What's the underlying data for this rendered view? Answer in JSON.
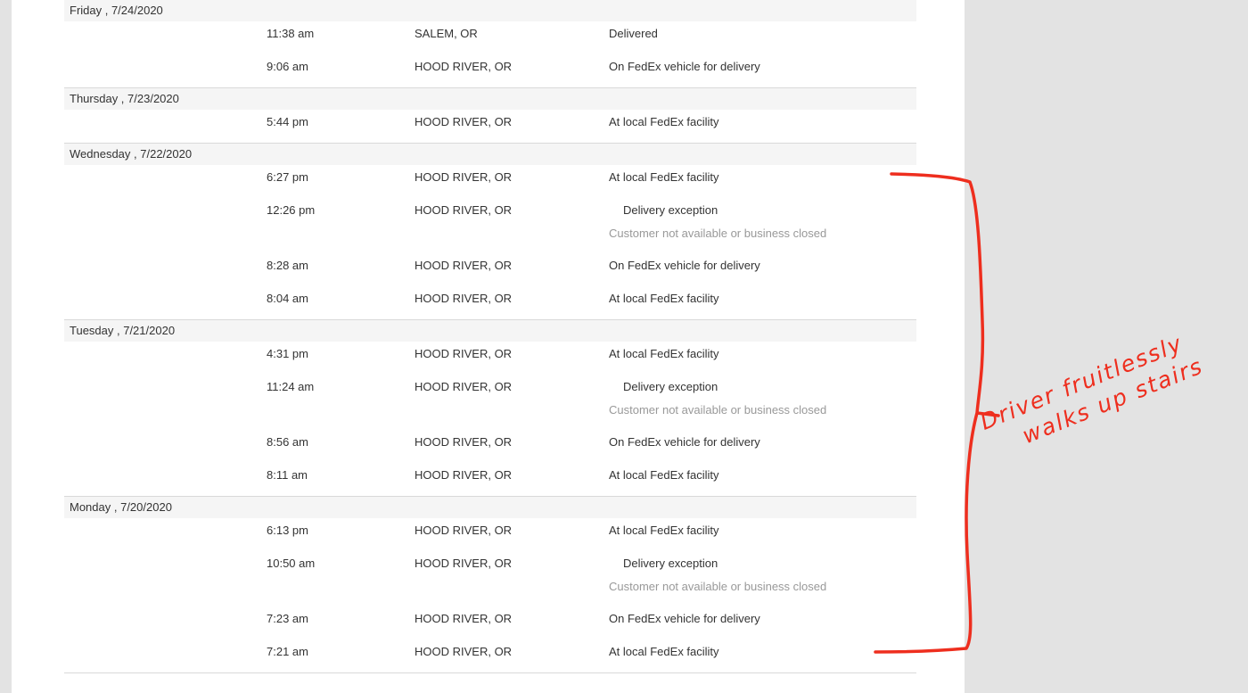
{
  "days": [
    {
      "date": "Friday , 7/24/2020",
      "events": [
        {
          "time": "11:38 am",
          "location": "SALEM, OR",
          "status": "Delivered"
        },
        {
          "time": "9:06 am",
          "location": "HOOD RIVER, OR",
          "status": "On FedEx vehicle for delivery"
        }
      ]
    },
    {
      "date": "Thursday , 7/23/2020",
      "events": [
        {
          "time": "5:44 pm",
          "location": "HOOD RIVER, OR",
          "status": "At local FedEx facility"
        }
      ]
    },
    {
      "date": "Wednesday , 7/22/2020",
      "events": [
        {
          "time": "6:27 pm",
          "location": "HOOD RIVER, OR",
          "status": "At local FedEx facility"
        },
        {
          "time": "12:26 pm",
          "location": "HOOD RIVER, OR",
          "status": "Delivery exception",
          "detail": "Customer not available or business closed"
        },
        {
          "time": "8:28 am",
          "location": "HOOD RIVER, OR",
          "status": "On FedEx vehicle for delivery"
        },
        {
          "time": "8:04 am",
          "location": "HOOD RIVER, OR",
          "status": "At local FedEx facility"
        }
      ]
    },
    {
      "date": "Tuesday , 7/21/2020",
      "events": [
        {
          "time": "4:31 pm",
          "location": "HOOD RIVER, OR",
          "status": "At local FedEx facility"
        },
        {
          "time": "11:24 am",
          "location": "HOOD RIVER, OR",
          "status": "Delivery exception",
          "detail": "Customer not available or business closed"
        },
        {
          "time": "8:56 am",
          "location": "HOOD RIVER, OR",
          "status": "On FedEx vehicle for delivery"
        },
        {
          "time": "8:11 am",
          "location": "HOOD RIVER, OR",
          "status": "At local FedEx facility"
        }
      ]
    },
    {
      "date": "Monday , 7/20/2020",
      "events": [
        {
          "time": "6:13 pm",
          "location": "HOOD RIVER, OR",
          "status": "At local FedEx facility"
        },
        {
          "time": "10:50 am",
          "location": "HOOD RIVER, OR",
          "status": "Delivery exception",
          "detail": "Customer not available or business closed"
        },
        {
          "time": "7:23 am",
          "location": "HOOD RIVER, OR",
          "status": "On FedEx vehicle for delivery"
        },
        {
          "time": "7:21 am",
          "location": "HOOD RIVER, OR",
          "status": "At local FedEx facility"
        }
      ]
    }
  ],
  "annotation": {
    "line1": "Driver fruitlessly",
    "line2": "walks up stairs",
    "color": "#ee2e1e"
  },
  "colors": {
    "background": "#e3e3e3",
    "panel": "#ffffff",
    "header_band": "#f5f5f5",
    "detail_text": "#999999"
  }
}
